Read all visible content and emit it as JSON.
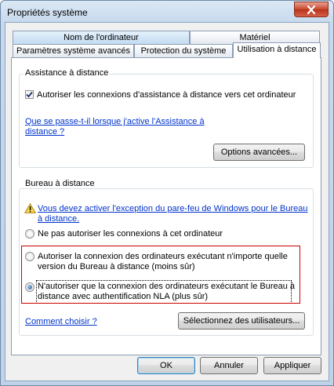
{
  "window": {
    "title": "Propriétés système"
  },
  "tabs_back": [
    "Nom de l'ordinateur",
    "Matériel"
  ],
  "tabs_front": [
    "Paramètres système avancés",
    "Protection du système",
    "Utilisation à distance"
  ],
  "assist": {
    "legend": "Assistance à distance",
    "checkbox_label": "Autoriser les connexions d'assistance à distance vers cet ordinateur",
    "link_line1": "Que se passe-t-il lorsque j'active l'Assistance à",
    "link_line2": "distance ?",
    "advanced_button": "Options avancées..."
  },
  "rdp": {
    "legend": "Bureau à distance",
    "warning_line1": "Vous devez activer l'exception du pare-feu de Windows pour le Bureau",
    "warning_line2": "à distance.",
    "opt1": "Ne pas autoriser les connexions à cet ordinateur",
    "opt2_line1": "Autoriser la connexion des ordinateurs exécutant n'importe quelle",
    "opt2_line2": "version du Bureau à distance (moins sûr)",
    "opt3_line1": "N'autoriser que la connexion des ordinateurs exécutant le Bureau à",
    "opt3_line2": "distance avec authentification NLA (plus sûr)",
    "choose_link": "Comment choisir ?",
    "select_users_button": "Sélectionnez des utilisateurs..."
  },
  "footer": {
    "ok": "OK",
    "cancel": "Annuler",
    "apply": "Appliquer"
  },
  "colors": {
    "link": "#0033cc",
    "highlight": "#cc0000"
  }
}
